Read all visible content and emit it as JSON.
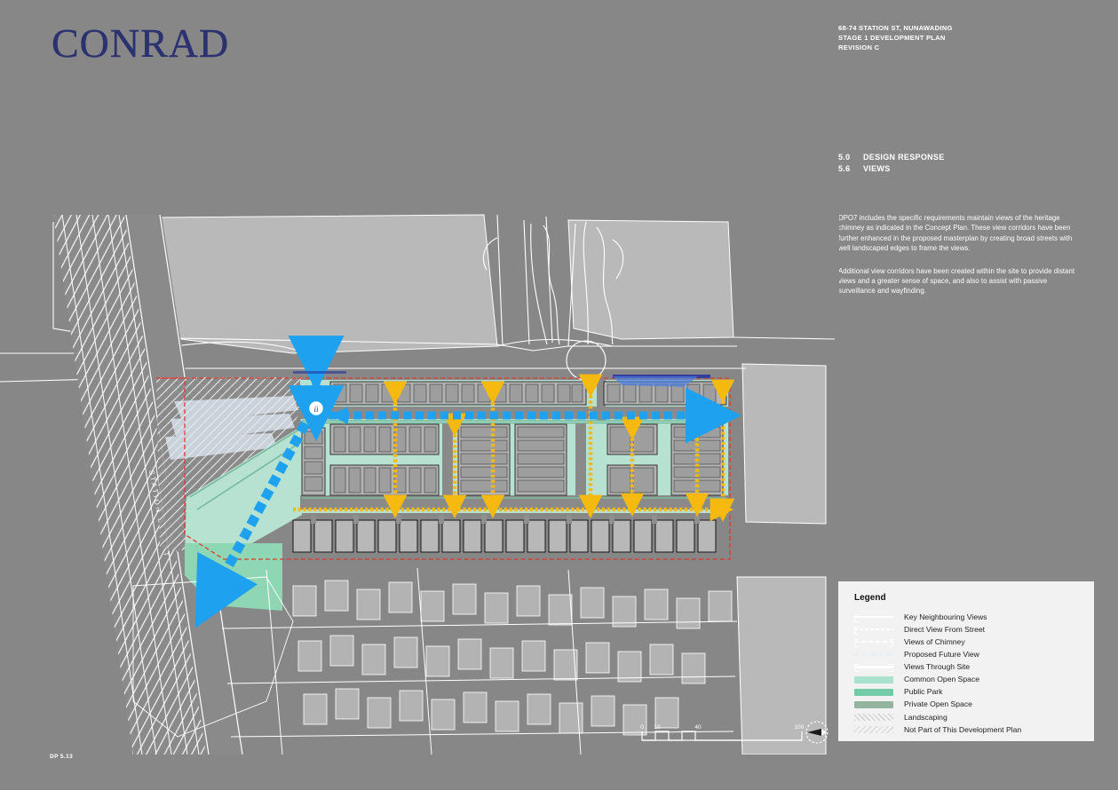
{
  "brand": {
    "logo": "CONRAD"
  },
  "header": {
    "line1": "68-74 STATION ST, NUNAWADING",
    "line2": "STAGE 1 DEVELOPMENT PLAN",
    "line3": "REVISION C"
  },
  "section": {
    "major_number": "5.0",
    "major_title": "DESIGN RESPONSE",
    "minor_number": "5.6",
    "minor_title": "VIEWS"
  },
  "body": {
    "paragraph1": "DPO7 includes the specific requirements maintain views of the heritage chimney as indicated in the Concept Plan. These view corridors have been further enhanced in the proposed masterplan by creating broad streets with well landscaped edges to frame the views.",
    "paragraph2": "Additional view corridors have been created within the site to provide distant views and a greater sense of space, and also to assist with passive surveillance and wayfinding."
  },
  "legend": {
    "title": "Legend",
    "items": [
      {
        "label": "Key Neighbouring Views",
        "swatch": "key-neighbouring-views-swatch"
      },
      {
        "label": "Direct View From Street",
        "swatch": "direct-view-from-street-swatch"
      },
      {
        "label": "Views of Chimney",
        "swatch": "views-of-chimney-swatch"
      },
      {
        "label": "Proposed Future View",
        "swatch": "proposed-future-view-swatch"
      },
      {
        "label": "Views Through Site",
        "swatch": "views-through-site-swatch"
      },
      {
        "label": "Common Open Space",
        "swatch": "common-open-space-swatch",
        "color": "#a9e3cd"
      },
      {
        "label": "Public Park",
        "swatch": "public-park-swatch",
        "color": "#74cba8"
      },
      {
        "label": "Private Open Space",
        "swatch": "private-open-space-swatch",
        "color": "#93b49e"
      },
      {
        "label": "Landscaping",
        "swatch": "landscaping-swatch"
      },
      {
        "label": "Not Part of This Development Plan",
        "swatch": "not-part-of-plan-swatch"
      }
    ]
  },
  "map": {
    "street_label": "STATION STREET",
    "chimney_marker": "chimney-view-origin"
  },
  "scale_bar": {
    "ticks": [
      "0",
      "10",
      "40",
      "100"
    ],
    "north_label": "N"
  },
  "footer": {
    "drawing_number": "DP 5.13"
  },
  "colors": {
    "page_background": "#878787",
    "brand_navy": "#2c3270",
    "view_arrow_blue": "#1ea2ef",
    "view_arrow_yellow": "#f5b90f",
    "site_boundary_red": "#e03a2f",
    "common_open_space": "#a9e3cd",
    "public_park": "#74cba8",
    "private_open_space": "#93b49e",
    "building_grey": "#b3b3b3",
    "legend_panel": "#f2f2f2"
  }
}
